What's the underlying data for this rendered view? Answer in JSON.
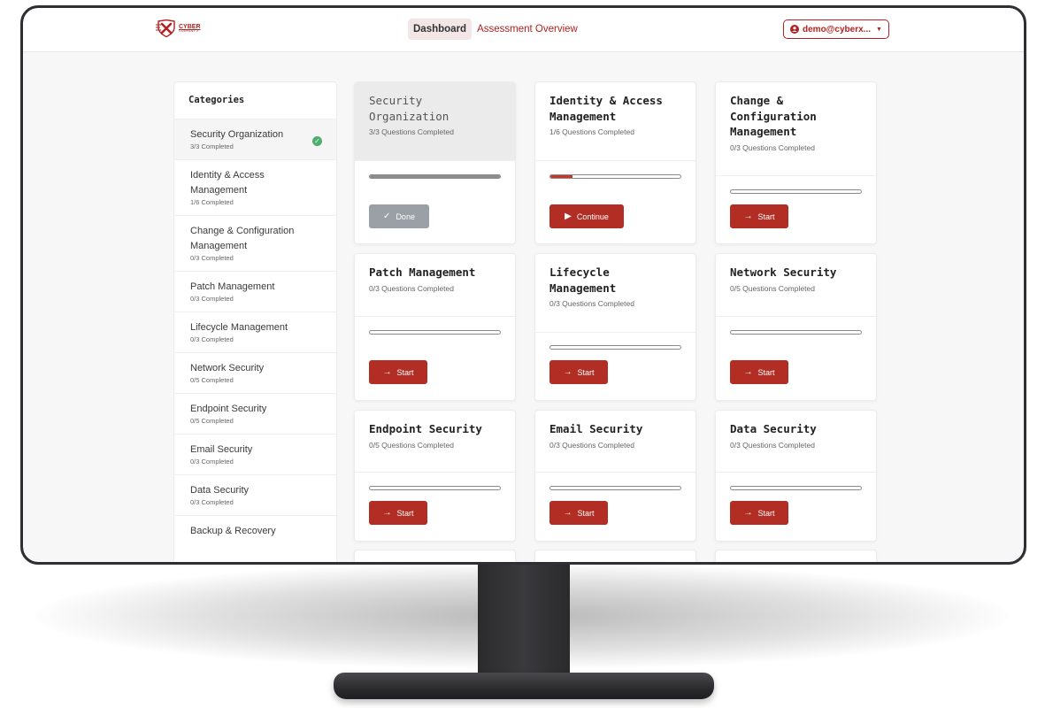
{
  "header": {
    "logo_line1": "CYBER",
    "logo_line2": "COMPANY X",
    "nav": [
      {
        "label": "Dashboard",
        "active": true
      },
      {
        "label": "Assessment Overview",
        "active": false
      }
    ],
    "user": "demo@cyberx..."
  },
  "sidebar": {
    "title": "Categories",
    "items": [
      {
        "name": "Security Organization",
        "progress": "3/3 Completed",
        "active": true,
        "complete": true
      },
      {
        "name": "Identity & Access Management",
        "progress": "1/6 Completed"
      },
      {
        "name": "Change & Configuration Management",
        "progress": "0/3 Completed"
      },
      {
        "name": "Patch Management",
        "progress": "0/3 Completed"
      },
      {
        "name": "Lifecycle Management",
        "progress": "0/3 Completed"
      },
      {
        "name": "Network Security",
        "progress": "0/5 Completed"
      },
      {
        "name": "Endpoint Security",
        "progress": "0/5 Completed"
      },
      {
        "name": "Email Security",
        "progress": "0/3 Completed"
      },
      {
        "name": "Data Security",
        "progress": "0/3 Completed"
      },
      {
        "name": "Backup & Recovery",
        "progress": ""
      }
    ]
  },
  "cards": [
    {
      "title": "Security Organization",
      "status": "3/3 Questions Completed",
      "progress": 1.0,
      "button": "Done",
      "state": "done"
    },
    {
      "title": "Identity & Access Management",
      "status": "1/6 Questions Completed",
      "progress": 0.1667,
      "button": "Continue",
      "state": "continue"
    },
    {
      "title": "Change & Configuration Management",
      "status": "0/3 Questions Completed",
      "progress": 0,
      "button": "Start",
      "state": "start"
    },
    {
      "title": "Patch Management",
      "status": "0/3 Questions Completed",
      "progress": 0,
      "button": "Start",
      "state": "start"
    },
    {
      "title": "Lifecycle Management",
      "status": "0/3 Questions Completed",
      "progress": 0,
      "button": "Start",
      "state": "start"
    },
    {
      "title": "Network Security",
      "status": "0/5 Questions Completed",
      "progress": 0,
      "button": "Start",
      "state": "start"
    },
    {
      "title": "Endpoint Security",
      "status": "0/5 Questions Completed",
      "progress": 0,
      "button": "Start",
      "state": "start"
    },
    {
      "title": "Email Security",
      "status": "0/3 Questions Completed",
      "progress": 0,
      "button": "Start",
      "state": "start"
    },
    {
      "title": "Data Security",
      "status": "0/3 Questions Completed",
      "progress": 0,
      "button": "Start",
      "state": "start"
    }
  ],
  "colors": {
    "accent": "#b22e25",
    "done": "#9aa0a6",
    "complete_check": "#4caf6d"
  }
}
